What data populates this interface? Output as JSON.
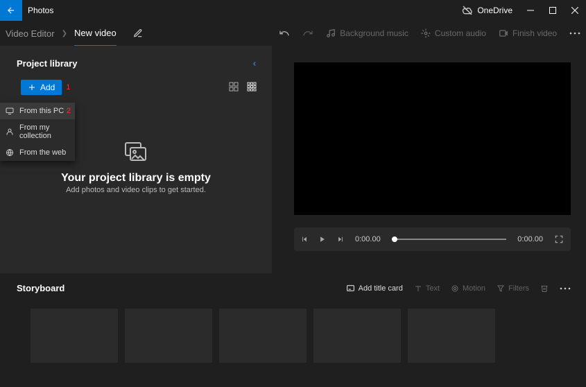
{
  "titlebar": {
    "app": "Photos",
    "onedrive": "OneDrive"
  },
  "breadcrumb": {
    "root": "Video Editor",
    "active": "New video"
  },
  "toolbar": {
    "bgmusic": "Background music",
    "customaudio": "Custom audio",
    "finish": "Finish video"
  },
  "library": {
    "title": "Project library",
    "add": "Add",
    "annot_add": "1",
    "dropdown": {
      "pc": "From this PC",
      "annot_pc": "2",
      "collection": "From my collection",
      "web": "From the web"
    },
    "empty_title": "Your project library is empty",
    "empty_sub": "Add photos and video clips to get started."
  },
  "player": {
    "current": "0:00.00",
    "total": "0:00.00"
  },
  "storyboard": {
    "title": "Storyboard",
    "addcard": "Add title card",
    "text": "Text",
    "motion": "Motion",
    "filters": "Filters"
  }
}
